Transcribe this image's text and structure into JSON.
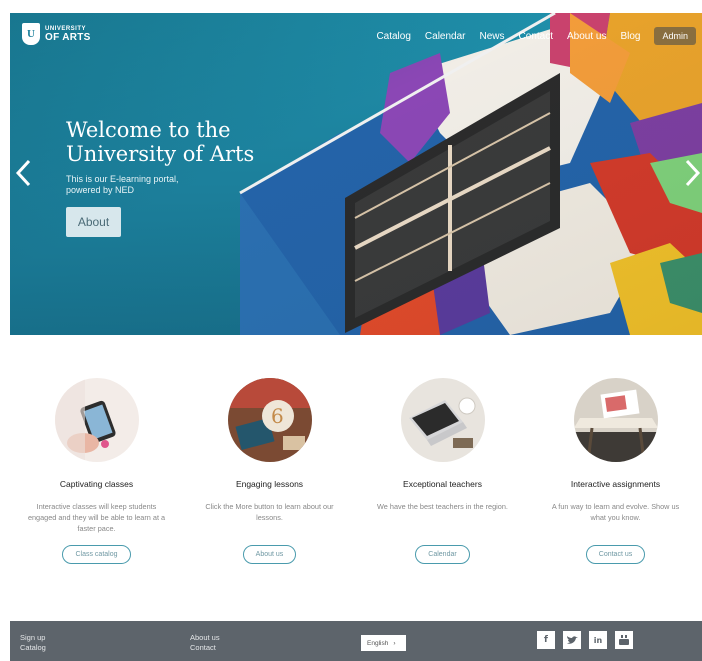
{
  "header": {
    "logo_line1": "UNIVERSITY",
    "logo_line2": "OF ARTS",
    "logo_mark": "U",
    "nav": [
      "Catalog",
      "Calendar",
      "News",
      "Contact",
      "About us",
      "Blog"
    ],
    "admin_label": "Admin"
  },
  "hero": {
    "title": "Welcome to the University of Arts",
    "subtitle": "This is our E-learning portal, powered by NED",
    "button_label": "About",
    "prev_icon": "chevron-left-icon",
    "next_icon": "chevron-right-icon"
  },
  "features": [
    {
      "title": "Captivating classes",
      "text": "Interactive classes will keep students engaged and they will be able to learn at a faster pace.",
      "button": "Class catalog"
    },
    {
      "title": "Engaging lessons",
      "text": "Click the More button to learn about our lessons.",
      "button": "About us"
    },
    {
      "title": "Exceptional teachers",
      "text": "We have the best teachers in the region.",
      "button": "Calendar"
    },
    {
      "title": "Interactive assignments",
      "text": "A fun way to learn and evolve. Show us what you know.",
      "button": "Contact us"
    }
  ],
  "footer": {
    "col1": [
      "Sign up",
      "Catalog"
    ],
    "col2": [
      "About us",
      "Contact"
    ],
    "language": "English",
    "social": [
      "f",
      "t",
      "in",
      "yt"
    ]
  },
  "colors": {
    "accent": "#4a9bad",
    "hero_bg": "#1c7f9b",
    "footer_bg": "#5d646b"
  }
}
